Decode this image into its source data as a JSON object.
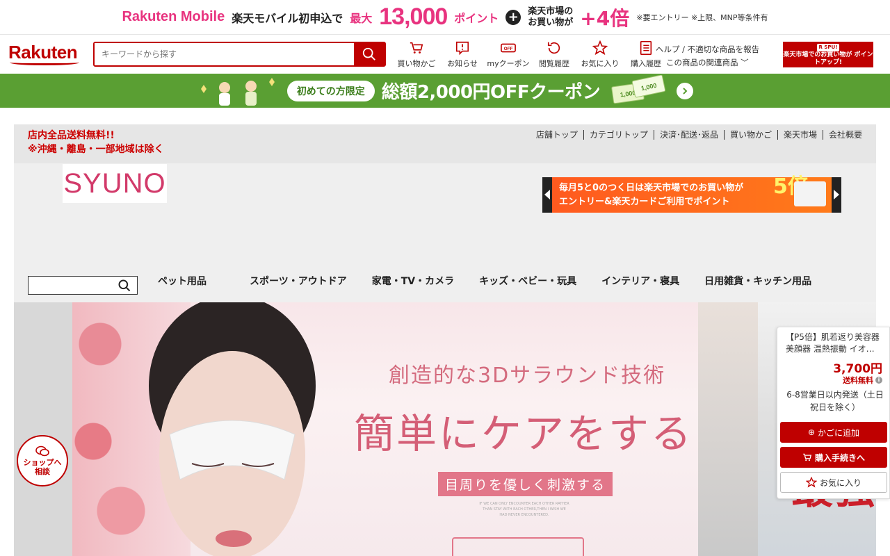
{
  "top_banner": {
    "brand": "Rakuten Mobile",
    "text": "楽天モバイル初申込で",
    "max_label": "最大",
    "points": "13,000",
    "points_label": "ポイント",
    "plus": "+",
    "ichiba_line1": "楽天市場の",
    "ichiba_line2": "お買い物が",
    "multiplier": "+4倍",
    "note": "※要エントリー ※上限、MNP等条件有"
  },
  "header": {
    "logo": "Rakuten",
    "search_placeholder": "キーワードから探す",
    "nav": [
      {
        "label": "買い物かご",
        "icon": "cart-icon"
      },
      {
        "label": "お知らせ",
        "icon": "notification-icon"
      },
      {
        "label": "myクーポン",
        "icon": "coupon-icon"
      },
      {
        "label": "閲覧履歴",
        "icon": "history-icon"
      },
      {
        "label": "お気に入り",
        "icon": "star-icon"
      },
      {
        "label": "購入履歴",
        "icon": "purchase-history-icon"
      }
    ],
    "help_link": "ヘルプ / 不適切な商品を報告",
    "related_link": "この商品の関連商品",
    "spu_tag": "R SPU!",
    "spu_text": "楽天市場でのお買い物が ポイントアップ!"
  },
  "coupon_banner": {
    "pill": "初めての方限定",
    "text": "総額2,000円OFFクーポン",
    "bill_label": "1,000"
  },
  "shop": {
    "shipping_line1": "店内全品送料無料!!",
    "shipping_line2": "※沖縄・離島・一部地域は除く",
    "links": [
      "店舗トップ",
      "カテゴリトップ",
      "決済･配送･返品",
      "買い物かご",
      "楽天市場",
      "会社概要"
    ],
    "logo": "SYUNO",
    "promo_line1": "毎月5と0のつく日は楽天市場でのお買い物が",
    "promo_line2": "エントリー&楽天カードご利用でポイント",
    "promo_mult": "5倍",
    "categories": [
      "ペット用品",
      "スポーツ・アウトドア",
      "家電・TV・カメラ",
      "キッズ・ベビー・玩具",
      "インテリア・寝具",
      "日用雑貨・キッチン用品"
    ]
  },
  "hero": {
    "line1": "創造的な3Dサラウンド技術",
    "line2": "簡単にケアをする",
    "line3": "目周りを優しく刺激する",
    "small_text": "IF WE CAN ONLY ENCOUNTER EACH OTHER RATHER THAN STAY WITH EACH OTHER,THEN I WISH WE HAD NEVER ENCOUNTERED.",
    "side_text": "最強"
  },
  "chat": {
    "line1": "ショップへ",
    "line2": "相談"
  },
  "sticky": {
    "title": "【P5倍】肌若返り美容器 美顔器 温熱振動 イオ…",
    "price": "3,700円",
    "shipping": "送料無料",
    "delivery": "6-8営業日以内発送（土日祝日を除く）",
    "add_cart": "かごに追加",
    "buy": "購入手続きへ",
    "favorite": "お気に入り"
  },
  "colors": {
    "rakuten_red": "#bf0000",
    "coupon_green": "#5a9f33",
    "mobile_pink": "#e8337f"
  }
}
